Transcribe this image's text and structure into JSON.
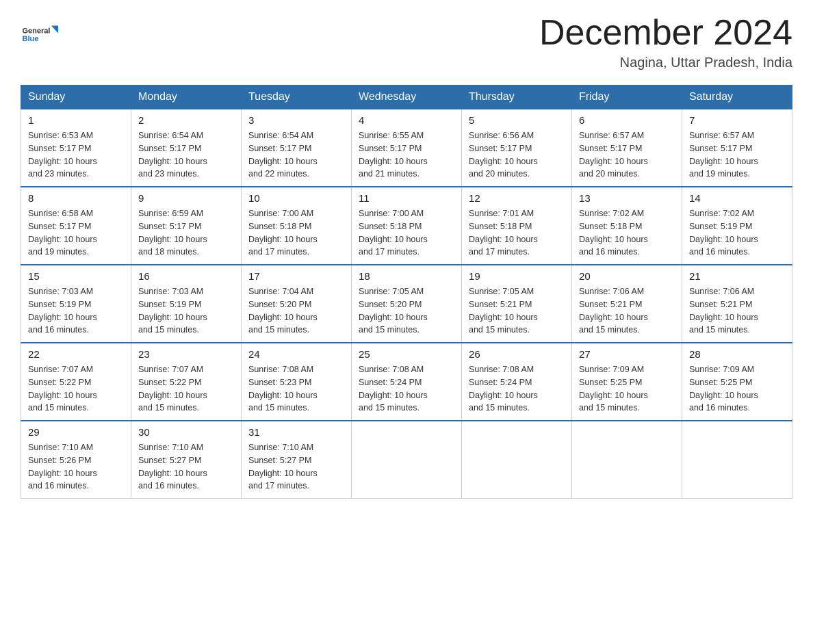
{
  "header": {
    "logo_general": "General",
    "logo_blue": "Blue",
    "title": "December 2024",
    "subtitle": "Nagina, Uttar Pradesh, India"
  },
  "days_of_week": [
    "Sunday",
    "Monday",
    "Tuesday",
    "Wednesday",
    "Thursday",
    "Friday",
    "Saturday"
  ],
  "weeks": [
    [
      {
        "day": "1",
        "sunrise": "6:53 AM",
        "sunset": "5:17 PM",
        "daylight": "10 hours and 23 minutes."
      },
      {
        "day": "2",
        "sunrise": "6:54 AM",
        "sunset": "5:17 PM",
        "daylight": "10 hours and 23 minutes."
      },
      {
        "day": "3",
        "sunrise": "6:54 AM",
        "sunset": "5:17 PM",
        "daylight": "10 hours and 22 minutes."
      },
      {
        "day": "4",
        "sunrise": "6:55 AM",
        "sunset": "5:17 PM",
        "daylight": "10 hours and 21 minutes."
      },
      {
        "day": "5",
        "sunrise": "6:56 AM",
        "sunset": "5:17 PM",
        "daylight": "10 hours and 20 minutes."
      },
      {
        "day": "6",
        "sunrise": "6:57 AM",
        "sunset": "5:17 PM",
        "daylight": "10 hours and 20 minutes."
      },
      {
        "day": "7",
        "sunrise": "6:57 AM",
        "sunset": "5:17 PM",
        "daylight": "10 hours and 19 minutes."
      }
    ],
    [
      {
        "day": "8",
        "sunrise": "6:58 AM",
        "sunset": "5:17 PM",
        "daylight": "10 hours and 19 minutes."
      },
      {
        "day": "9",
        "sunrise": "6:59 AM",
        "sunset": "5:17 PM",
        "daylight": "10 hours and 18 minutes."
      },
      {
        "day": "10",
        "sunrise": "7:00 AM",
        "sunset": "5:18 PM",
        "daylight": "10 hours and 17 minutes."
      },
      {
        "day": "11",
        "sunrise": "7:00 AM",
        "sunset": "5:18 PM",
        "daylight": "10 hours and 17 minutes."
      },
      {
        "day": "12",
        "sunrise": "7:01 AM",
        "sunset": "5:18 PM",
        "daylight": "10 hours and 17 minutes."
      },
      {
        "day": "13",
        "sunrise": "7:02 AM",
        "sunset": "5:18 PM",
        "daylight": "10 hours and 16 minutes."
      },
      {
        "day": "14",
        "sunrise": "7:02 AM",
        "sunset": "5:19 PM",
        "daylight": "10 hours and 16 minutes."
      }
    ],
    [
      {
        "day": "15",
        "sunrise": "7:03 AM",
        "sunset": "5:19 PM",
        "daylight": "10 hours and 16 minutes."
      },
      {
        "day": "16",
        "sunrise": "7:03 AM",
        "sunset": "5:19 PM",
        "daylight": "10 hours and 15 minutes."
      },
      {
        "day": "17",
        "sunrise": "7:04 AM",
        "sunset": "5:20 PM",
        "daylight": "10 hours and 15 minutes."
      },
      {
        "day": "18",
        "sunrise": "7:05 AM",
        "sunset": "5:20 PM",
        "daylight": "10 hours and 15 minutes."
      },
      {
        "day": "19",
        "sunrise": "7:05 AM",
        "sunset": "5:21 PM",
        "daylight": "10 hours and 15 minutes."
      },
      {
        "day": "20",
        "sunrise": "7:06 AM",
        "sunset": "5:21 PM",
        "daylight": "10 hours and 15 minutes."
      },
      {
        "day": "21",
        "sunrise": "7:06 AM",
        "sunset": "5:21 PM",
        "daylight": "10 hours and 15 minutes."
      }
    ],
    [
      {
        "day": "22",
        "sunrise": "7:07 AM",
        "sunset": "5:22 PM",
        "daylight": "10 hours and 15 minutes."
      },
      {
        "day": "23",
        "sunrise": "7:07 AM",
        "sunset": "5:22 PM",
        "daylight": "10 hours and 15 minutes."
      },
      {
        "day": "24",
        "sunrise": "7:08 AM",
        "sunset": "5:23 PM",
        "daylight": "10 hours and 15 minutes."
      },
      {
        "day": "25",
        "sunrise": "7:08 AM",
        "sunset": "5:24 PM",
        "daylight": "10 hours and 15 minutes."
      },
      {
        "day": "26",
        "sunrise": "7:08 AM",
        "sunset": "5:24 PM",
        "daylight": "10 hours and 15 minutes."
      },
      {
        "day": "27",
        "sunrise": "7:09 AM",
        "sunset": "5:25 PM",
        "daylight": "10 hours and 15 minutes."
      },
      {
        "day": "28",
        "sunrise": "7:09 AM",
        "sunset": "5:25 PM",
        "daylight": "10 hours and 16 minutes."
      }
    ],
    [
      {
        "day": "29",
        "sunrise": "7:10 AM",
        "sunset": "5:26 PM",
        "daylight": "10 hours and 16 minutes."
      },
      {
        "day": "30",
        "sunrise": "7:10 AM",
        "sunset": "5:27 PM",
        "daylight": "10 hours and 16 minutes."
      },
      {
        "day": "31",
        "sunrise": "7:10 AM",
        "sunset": "5:27 PM",
        "daylight": "10 hours and 17 minutes."
      },
      null,
      null,
      null,
      null
    ]
  ],
  "labels": {
    "sunrise": "Sunrise:",
    "sunset": "Sunset:",
    "daylight": "Daylight:"
  }
}
